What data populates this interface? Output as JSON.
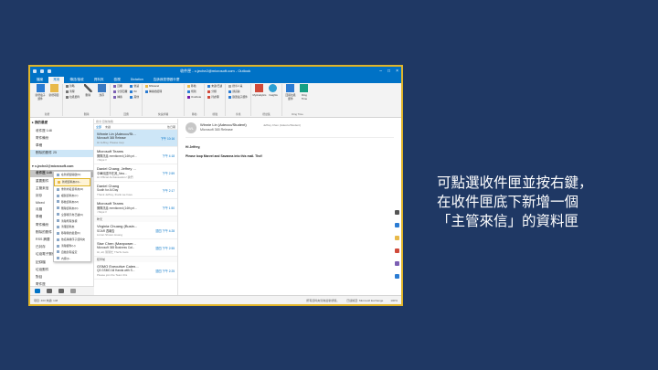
{
  "window": {
    "title": "收件匣 - v-jeche2@microsoft.com - Outlook",
    "tabs": [
      "檔案",
      "常用",
      "傳送/接收",
      "資料夾",
      "檢視",
      "Dictation",
      "告訴我您想做什麼"
    ]
  },
  "ribbon": {
    "groups": [
      {
        "label": "新增",
        "buttons": [
          "新增電子郵件",
          "新增項目"
        ]
      },
      {
        "label": "刪除",
        "buttons": [
          "忽略",
          "清理",
          "垃圾郵件",
          "刪除",
          "封存"
        ]
      },
      {
        "label": "回應",
        "buttons": [
          "回覆",
          "全部回覆",
          "轉寄",
          "會議",
          "IM",
          "其他"
        ]
      },
      {
        "label": "快速步驟",
        "buttons": [
          "MSstand",
          "轉寄給經理"
        ]
      },
      {
        "label": "移動",
        "buttons": [
          "移動",
          "規則",
          "OneNote"
        ]
      },
      {
        "label": "標籤",
        "buttons": [
          "未讀/已讀",
          "分類",
          "待處理"
        ]
      },
      {
        "label": "尋找",
        "buttons": [
          "搜尋人員",
          "通訊錄",
          "篩選電子郵件"
        ]
      },
      {
        "label": "增益集",
        "buttons": [
          "MyAnalytics",
          "Insights"
        ]
      },
      {
        "label": "Ding Time",
        "buttons": [
          "回報垃圾郵件",
          "Ding Time"
        ]
      }
    ]
  },
  "folders": {
    "favorites_header": "我的最愛",
    "favorites": [
      "收件匣 148",
      "寄件備份",
      "草稿",
      "刪除的郵件 25"
    ],
    "account": "v-jeche2@microsoft.com",
    "inbox": "收件匣 148",
    "items": [
      "重要郵件",
      "主管來信",
      "封存",
      "Mixed",
      "月曆",
      "草稿",
      "寄件備份",
      "刪除的郵件",
      "RSS 摘要",
      "已封存",
      "垃圾電子郵件",
      "記錄檔",
      "垃圾郵件",
      "對話",
      "寄件匣",
      "搜尋資料夾",
      "群組"
    ]
  },
  "context_menu": {
    "items": [
      "在新視窗開啟(N)",
      "新增資料夾(N)...",
      "重新命名資料夾(R)",
      "複製資料夾(C)",
      "移動資料夾(M)",
      "刪除資料夾(D)",
      "全部標示為已讀(K)",
      "清除所有旗標",
      "清理資料夾",
      "移除我的最愛(F)",
      "依名稱排序子資料夾",
      "清除郵件(U)",
      "自動封存設定",
      "內容(I)..."
    ],
    "highlighted_index": 1
  },
  "message_list": {
    "search_placeholder": "搜尋 目前信箱",
    "filters": [
      "全部",
      "未讀"
    ],
    "sort": "依日期",
    "messages": [
      {
        "from": "Winnie Lin (Adecco/St...",
        "subject": "Microsoft 365 Release",
        "time": "下午 10:16",
        "preview": "Hi Jeffrey, Please loop"
      },
      {
        "from": "Microsoft Teams",
        "subject": "團隊訊息 mentioned (14th pri...",
        "time": "下午 4:18",
        "preview": "<https://"
      },
      {
        "from": "Daniel Chang; Jeffrey ...",
        "subject": "中華民國不在其_Nea...",
        "time": "下午 2:59",
        "preview": "Hi Official Ambassadors! 我們"
      },
      {
        "from": "Daniel Chang",
        "subject": "Sooth for AI Day",
        "time": "下午 2:17",
        "preview": "Thank Jeffrey, thank we have"
      },
      {
        "from": "Microsoft Teams",
        "subject": "團隊訊息 mentioned (14th pri...",
        "time": "下午 1:50",
        "preview": "<https://"
      }
    ],
    "group_label": "昨天",
    "messages_2": [
      {
        "from": "Virginia Chuang (Busin...",
        "subject": "SOAR 週報告",
        "time": "週四 下午 4:28",
        "preview": "Linran Shown Huang"
      },
      {
        "from": "Sise Chen (Manpower...",
        "subject": "Microsoft 365 Business Cal...",
        "time": "週四 下午 2:55",
        "preview": "Hi, all, 幫幫忙 TheTe Gets"
      },
      {
        "from": "GSMO Executive Calen...",
        "subject": "Q3 GSMO All Hands with S...",
        "time": "週四 下午 2:25",
        "preview": "Please join the Team this"
      }
    ],
    "group_label_2": "較早前"
  },
  "reading": {
    "avatar_initials": "WL",
    "from": "Winnie Lin (Adecco/Student)",
    "to": "Jeffrey Chen (Adecco/Student)",
    "subject": "Microsoft 365 Release",
    "greeting": "Hi Jeffrey,",
    "body": "Please loop Marvel and Savanna into this mail. Thx!!"
  },
  "status": {
    "left": "項目: 463   未讀: 148",
    "center": "所有資料夾皆為最新狀態。",
    "connection": "已連線至: Microsoft Exchange",
    "zoom": "100%"
  },
  "caption": {
    "line1": "可點選收件匣並按右鍵，",
    "line2": "在收件匣底下新增一個",
    "line3": "「主管來信」的資料匣"
  },
  "colors": {
    "accent": "#0072c6",
    "highlight": "#e0b52a",
    "slide_bg": "#1f3864"
  }
}
